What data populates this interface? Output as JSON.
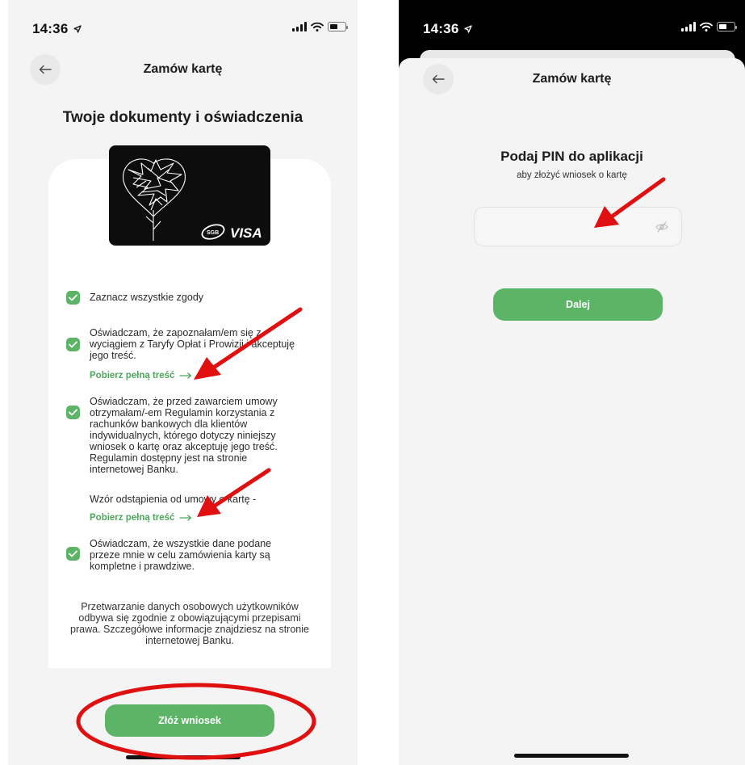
{
  "left_screen": {
    "status": {
      "time": "14:36"
    },
    "header": {
      "title": "Zamów kartę"
    },
    "section_title": "Twoje dokumenty i oświadczenia",
    "card": {
      "brand": "VISA",
      "issuer_badge": "SGB"
    },
    "consents": [
      {
        "text": "Zaznacz wszystkie zgody",
        "checked": true
      },
      {
        "text": "Oświadczam, że zapoznałam/em się z wyciągiem z Taryfy Opłat i Prowizji i akceptuję jego treść.",
        "checked": true,
        "link": "Pobierz pełną treść"
      },
      {
        "text": "Oświadczam, że przed zawarciem umowy otrzymałam/-em Regulamin korzystania z rachunków bankowych dla klientów indywidualnych, którego dotyczy niniejszy wniosek o kartę oraz akceptuję jego treść. Regulamin dostępny jest na stronie internetowej Banku.",
        "checked": true
      },
      {
        "text": "Oświadczam, że wszystkie dane podane przeze mnie w celu zamówienia karty są kompletne i prawdziwe.",
        "checked": true
      }
    ],
    "withdrawal": {
      "text": "Wzór odstąpienia od umowy o kartę -",
      "link": "Pobierz pełną treść"
    },
    "note": "Przetwarzanie danych osobowych użytkowników odbywa się zgodnie z obowiązującymi przepisami prawa. Szczegółowe informacje znajdziesz na stronie internetowej Banku.",
    "submit_label": "Złóż wniosek"
  },
  "right_screen": {
    "status": {
      "time": "14:36"
    },
    "header": {
      "title": "Zamów kartę"
    },
    "pin_title": "Podaj PIN do aplikacji",
    "pin_subtitle": "aby złożyć wniosek o kartę",
    "pin_value": "",
    "next_label": "Dalej"
  },
  "colors": {
    "accent_green": "#5cb467",
    "link_green": "#4fa75c",
    "annotation_red": "#e01010",
    "background": "#f3f4f3"
  },
  "icons": [
    "arrow-left-icon",
    "check-icon",
    "arrow-right-icon",
    "eye-off-icon",
    "location-arrow-icon",
    "signal-icon",
    "wifi-icon",
    "battery-icon"
  ]
}
